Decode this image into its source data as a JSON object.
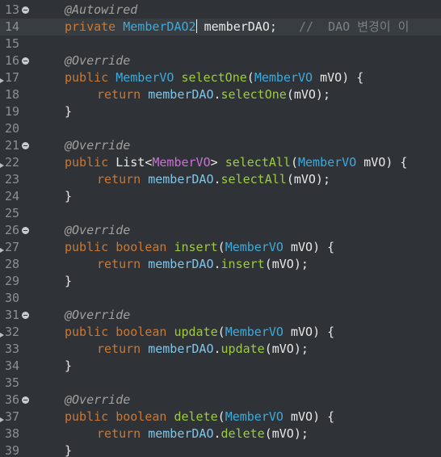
{
  "editor": {
    "lines": [
      {
        "num": "13",
        "fold": true,
        "override": false,
        "current": false,
        "indent": 0,
        "tokens": [
          {
            "t": "@Autowired",
            "c": "anno"
          }
        ]
      },
      {
        "num": "14",
        "fold": false,
        "override": false,
        "current": true,
        "indent": 0,
        "tokens": [
          {
            "t": "private ",
            "c": "kw"
          },
          {
            "t": "MemberDAO2",
            "c": "type"
          },
          {
            "t": "",
            "c": "caret"
          },
          {
            "t": " memberDAO",
            "c": "ident"
          },
          {
            "t": ";   ",
            "c": "punct"
          },
          {
            "t": "//  DAO 변경이 이",
            "c": "comment"
          }
        ]
      },
      {
        "num": "15",
        "fold": false,
        "override": false,
        "current": false,
        "indent": 0,
        "tokens": []
      },
      {
        "num": "16",
        "fold": true,
        "override": false,
        "current": false,
        "indent": 0,
        "tokens": [
          {
            "t": "@Override",
            "c": "anno"
          }
        ]
      },
      {
        "num": "17",
        "fold": false,
        "override": true,
        "current": false,
        "indent": 0,
        "tokens": [
          {
            "t": "public ",
            "c": "kw"
          },
          {
            "t": "MemberVO",
            "c": "type"
          },
          {
            "t": " ",
            "c": "punct"
          },
          {
            "t": "selectOne",
            "c": "method"
          },
          {
            "t": "(",
            "c": "punct"
          },
          {
            "t": "MemberVO",
            "c": "type"
          },
          {
            "t": " mVO",
            "c": "ident"
          },
          {
            "t": ") {",
            "c": "punct"
          }
        ]
      },
      {
        "num": "18",
        "fold": false,
        "override": false,
        "current": false,
        "indent": 1,
        "tokens": [
          {
            "t": "return ",
            "c": "kw"
          },
          {
            "t": "memberDAO",
            "c": "field"
          },
          {
            "t": ".",
            "c": "punct"
          },
          {
            "t": "selectOne",
            "c": "method"
          },
          {
            "t": "(mVO);",
            "c": "punct"
          }
        ]
      },
      {
        "num": "19",
        "fold": false,
        "override": false,
        "current": false,
        "indent": 0,
        "tokens": [
          {
            "t": "}",
            "c": "punct"
          }
        ]
      },
      {
        "num": "20",
        "fold": false,
        "override": false,
        "current": false,
        "indent": 0,
        "tokens": []
      },
      {
        "num": "21",
        "fold": true,
        "override": false,
        "current": false,
        "indent": 0,
        "tokens": [
          {
            "t": "@Override",
            "c": "anno"
          }
        ]
      },
      {
        "num": "22",
        "fold": false,
        "override": true,
        "current": false,
        "indent": 0,
        "tokens": [
          {
            "t": "public ",
            "c": "kw"
          },
          {
            "t": "List",
            "c": "ident"
          },
          {
            "t": "<",
            "c": "punct"
          },
          {
            "t": "MemberVO",
            "c": "generic"
          },
          {
            "t": "> ",
            "c": "punct"
          },
          {
            "t": "selectAll",
            "c": "method"
          },
          {
            "t": "(",
            "c": "punct"
          },
          {
            "t": "MemberVO",
            "c": "type"
          },
          {
            "t": " mVO",
            "c": "ident"
          },
          {
            "t": ") {",
            "c": "punct"
          }
        ]
      },
      {
        "num": "23",
        "fold": false,
        "override": false,
        "current": false,
        "indent": 1,
        "tokens": [
          {
            "t": "return ",
            "c": "kw"
          },
          {
            "t": "memberDAO",
            "c": "field"
          },
          {
            "t": ".",
            "c": "punct"
          },
          {
            "t": "selectAll",
            "c": "method"
          },
          {
            "t": "(mVO);",
            "c": "punct"
          }
        ]
      },
      {
        "num": "24",
        "fold": false,
        "override": false,
        "current": false,
        "indent": 0,
        "tokens": [
          {
            "t": "}",
            "c": "punct"
          }
        ]
      },
      {
        "num": "25",
        "fold": false,
        "override": false,
        "current": false,
        "indent": 0,
        "tokens": []
      },
      {
        "num": "26",
        "fold": true,
        "override": false,
        "current": false,
        "indent": 0,
        "tokens": [
          {
            "t": "@Override",
            "c": "anno"
          }
        ]
      },
      {
        "num": "27",
        "fold": false,
        "override": true,
        "current": false,
        "indent": 0,
        "tokens": [
          {
            "t": "public ",
            "c": "kw"
          },
          {
            "t": "boolean ",
            "c": "kw"
          },
          {
            "t": "insert",
            "c": "method"
          },
          {
            "t": "(",
            "c": "punct"
          },
          {
            "t": "MemberVO",
            "c": "type"
          },
          {
            "t": " mVO",
            "c": "ident"
          },
          {
            "t": ") {",
            "c": "punct"
          }
        ]
      },
      {
        "num": "28",
        "fold": false,
        "override": false,
        "current": false,
        "indent": 1,
        "tokens": [
          {
            "t": "return ",
            "c": "kw"
          },
          {
            "t": "memberDAO",
            "c": "field"
          },
          {
            "t": ".",
            "c": "punct"
          },
          {
            "t": "insert",
            "c": "method"
          },
          {
            "t": "(mVO);",
            "c": "punct"
          }
        ]
      },
      {
        "num": "29",
        "fold": false,
        "override": false,
        "current": false,
        "indent": 0,
        "tokens": [
          {
            "t": "}",
            "c": "punct"
          }
        ]
      },
      {
        "num": "30",
        "fold": false,
        "override": false,
        "current": false,
        "indent": 0,
        "tokens": []
      },
      {
        "num": "31",
        "fold": true,
        "override": false,
        "current": false,
        "indent": 0,
        "tokens": [
          {
            "t": "@Override",
            "c": "anno"
          }
        ]
      },
      {
        "num": "32",
        "fold": false,
        "override": true,
        "current": false,
        "indent": 0,
        "tokens": [
          {
            "t": "public ",
            "c": "kw"
          },
          {
            "t": "boolean ",
            "c": "kw"
          },
          {
            "t": "update",
            "c": "method"
          },
          {
            "t": "(",
            "c": "punct"
          },
          {
            "t": "MemberVO",
            "c": "type"
          },
          {
            "t": " mVO",
            "c": "ident"
          },
          {
            "t": ") {",
            "c": "punct"
          }
        ]
      },
      {
        "num": "33",
        "fold": false,
        "override": false,
        "current": false,
        "indent": 1,
        "tokens": [
          {
            "t": "return ",
            "c": "kw"
          },
          {
            "t": "memberDAO",
            "c": "field"
          },
          {
            "t": ".",
            "c": "punct"
          },
          {
            "t": "update",
            "c": "method"
          },
          {
            "t": "(mVO);",
            "c": "punct"
          }
        ]
      },
      {
        "num": "34",
        "fold": false,
        "override": false,
        "current": false,
        "indent": 0,
        "tokens": [
          {
            "t": "}",
            "c": "punct"
          }
        ]
      },
      {
        "num": "35",
        "fold": false,
        "override": false,
        "current": false,
        "indent": 0,
        "tokens": []
      },
      {
        "num": "36",
        "fold": true,
        "override": false,
        "current": false,
        "indent": 0,
        "tokens": [
          {
            "t": "@Override",
            "c": "anno"
          }
        ]
      },
      {
        "num": "37",
        "fold": false,
        "override": true,
        "current": false,
        "indent": 0,
        "tokens": [
          {
            "t": "public ",
            "c": "kw"
          },
          {
            "t": "boolean ",
            "c": "kw"
          },
          {
            "t": "delete",
            "c": "method"
          },
          {
            "t": "(",
            "c": "punct"
          },
          {
            "t": "MemberVO",
            "c": "type"
          },
          {
            "t": " mVO",
            "c": "ident"
          },
          {
            "t": ") {",
            "c": "punct"
          }
        ]
      },
      {
        "num": "38",
        "fold": false,
        "override": false,
        "current": false,
        "indent": 1,
        "tokens": [
          {
            "t": "return ",
            "c": "kw"
          },
          {
            "t": "memberDAO",
            "c": "field"
          },
          {
            "t": ".",
            "c": "punct"
          },
          {
            "t": "delete",
            "c": "method"
          },
          {
            "t": "(mVO);",
            "c": "punct"
          }
        ]
      },
      {
        "num": "39",
        "fold": false,
        "override": false,
        "current": false,
        "indent": 0,
        "tokens": [
          {
            "t": "}",
            "c": "punct"
          }
        ]
      }
    ]
  }
}
